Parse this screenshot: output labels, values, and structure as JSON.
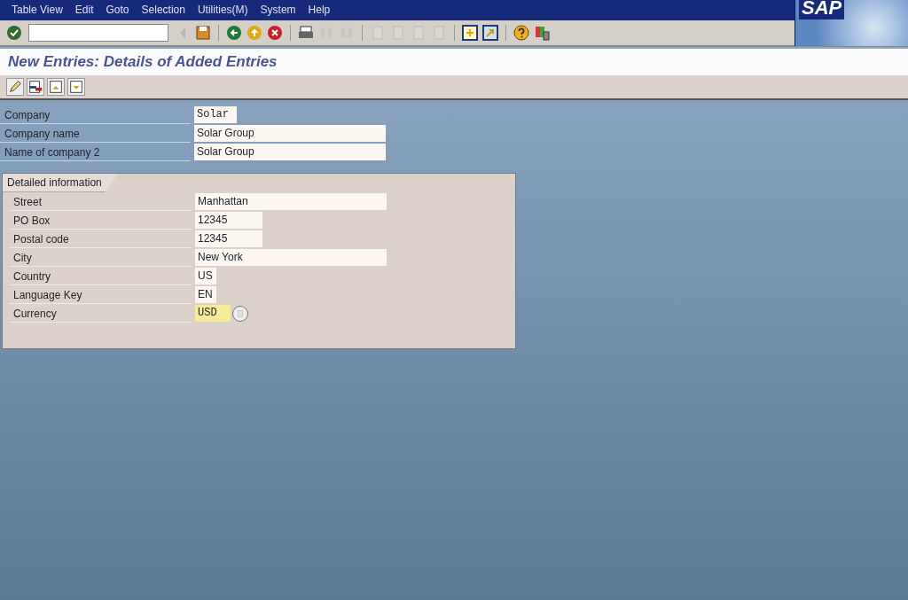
{
  "menu": [
    "Table View",
    "Edit",
    "Goto",
    "Selection",
    "Utilities(M)",
    "System",
    "Help"
  ],
  "toolbar": [
    {
      "kind": "enter",
      "disabled": false
    },
    {
      "kind": "command-field",
      "disabled": false
    },
    {
      "kind": "left",
      "disabled": true
    },
    {
      "kind": "save",
      "disabled": false
    },
    {
      "kind": "sep",
      "disabled": false
    },
    {
      "kind": "back",
      "disabled": false
    },
    {
      "kind": "exit",
      "disabled": false
    },
    {
      "kind": "cancel",
      "disabled": false
    },
    {
      "kind": "sep",
      "disabled": false
    },
    {
      "kind": "print",
      "disabled": false
    },
    {
      "kind": "find",
      "disabled": true
    },
    {
      "kind": "find-next",
      "disabled": true
    },
    {
      "kind": "sep",
      "disabled": false
    },
    {
      "kind": "page",
      "disabled": true
    },
    {
      "kind": "page",
      "disabled": true
    },
    {
      "kind": "page",
      "disabled": true
    },
    {
      "kind": "page",
      "disabled": true
    },
    {
      "kind": "sep",
      "disabled": false
    },
    {
      "kind": "new-session",
      "disabled": false
    },
    {
      "kind": "shortcut",
      "disabled": false
    },
    {
      "kind": "sep",
      "disabled": false
    },
    {
      "kind": "help",
      "disabled": false
    },
    {
      "kind": "layout",
      "disabled": false
    }
  ],
  "brand": "SAP",
  "title": "New Entries: Details of Added Entries",
  "app_toolbar": [
    {
      "kind": "pencil"
    },
    {
      "kind": "doc-red"
    },
    {
      "kind": "doc-prev"
    },
    {
      "kind": "doc-next"
    }
  ],
  "fields": [
    {
      "label": "Company",
      "value": "Solar",
      "kind": "short",
      "focused": false
    },
    {
      "label": "Company name",
      "value": "Solar Group",
      "kind": "long",
      "focused": false
    },
    {
      "label": "Name of company 2",
      "value": "Solar Group",
      "kind": "long",
      "focused": false
    }
  ],
  "group": {
    "title": "Detailed information",
    "fields": [
      {
        "label": "Street",
        "value": "Manhattan",
        "kind": "long",
        "focused": false,
        "value_help": false
      },
      {
        "label": "PO Box",
        "value": "12345",
        "kind": "medium",
        "focused": false,
        "value_help": false
      },
      {
        "label": "Postal code",
        "value": "12345",
        "kind": "medium",
        "focused": false,
        "value_help": false
      },
      {
        "label": "City",
        "value": "New York",
        "kind": "long",
        "focused": false,
        "value_help": false
      },
      {
        "label": "Country",
        "value": "US",
        "kind": "tiny",
        "focused": false,
        "value_help": false
      },
      {
        "label": "Language Key",
        "value": "EN",
        "kind": "tiny",
        "focused": false,
        "value_help": false
      },
      {
        "label": "Currency",
        "value": "USD",
        "kind": "currency",
        "focused": true,
        "value_help": true
      }
    ]
  }
}
